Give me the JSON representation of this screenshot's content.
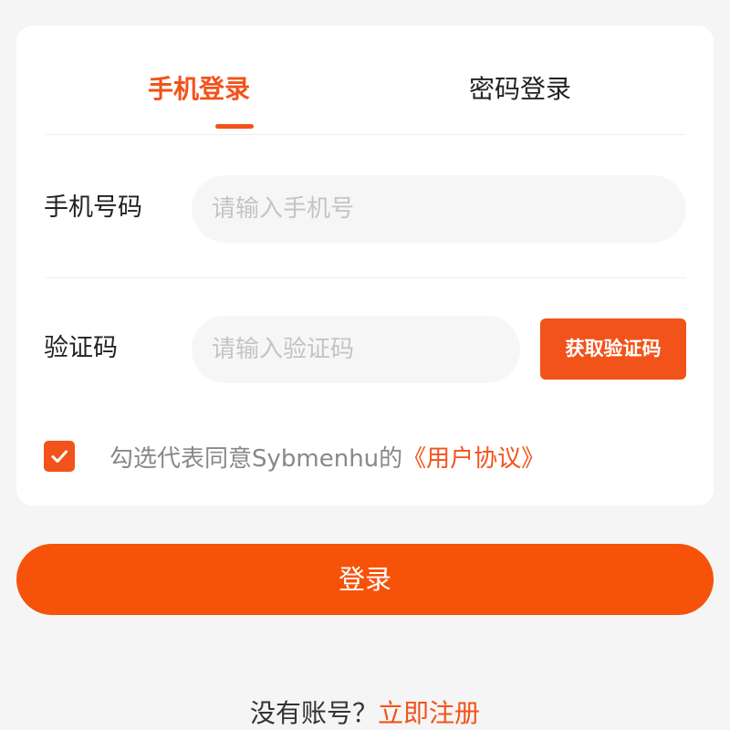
{
  "tabs": {
    "active_label": "手机登录",
    "inactive_label": "密码登录"
  },
  "phone": {
    "label": "手机号码",
    "placeholder": "请输入手机号",
    "value": ""
  },
  "code": {
    "label": "验证码",
    "placeholder": "请输入验证码",
    "value": "",
    "button_label": "获取验证码"
  },
  "agreement": {
    "checked": true,
    "text": "勾选代表同意Sybmenhu的",
    "link": "《用户协议》"
  },
  "login_button": "登录",
  "footer": {
    "text": "没有账号？",
    "link": "立即注册"
  },
  "colors": {
    "accent": "#f2531a",
    "background": "#f5f5f5",
    "card": "#ffffff",
    "input_bg": "#f6f6f6"
  },
  "icons": {
    "checkbox": "checkmark-icon"
  }
}
